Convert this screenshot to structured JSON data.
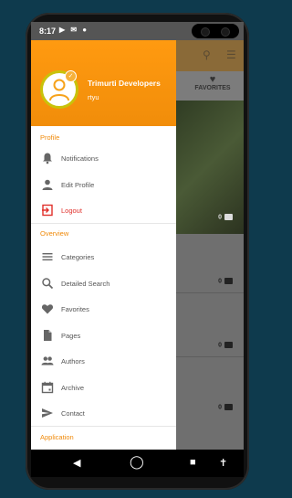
{
  "status_bar": {
    "time": "8:17",
    "icons": "▶ ✉ ●"
  },
  "drawer": {
    "user": {
      "name": "Trimurti Developers",
      "subtitle": "rtyu"
    },
    "sections": {
      "profile": "Profile",
      "overview": "Overview",
      "application": "Application"
    },
    "profile_items": [
      {
        "label": "Notifications",
        "icon": "bell-icon"
      },
      {
        "label": "Edit Profile",
        "icon": "person-icon"
      },
      {
        "label": "Logout",
        "icon": "logout-icon"
      }
    ],
    "overview_items": [
      {
        "label": "Categories",
        "icon": "menu-icon"
      },
      {
        "label": "Detailed Search",
        "icon": "search-icon"
      },
      {
        "label": "Favorites",
        "icon": "heart-icon"
      },
      {
        "label": "Pages",
        "icon": "document-icon"
      },
      {
        "label": "Authors",
        "icon": "people-icon"
      },
      {
        "label": "Archive",
        "icon": "calendar-icon"
      },
      {
        "label": "Contact",
        "icon": "send-icon"
      }
    ]
  },
  "background_app": {
    "tab_favorites": "FAVORITES",
    "counts": [
      "0",
      "0",
      "0",
      "0"
    ]
  }
}
